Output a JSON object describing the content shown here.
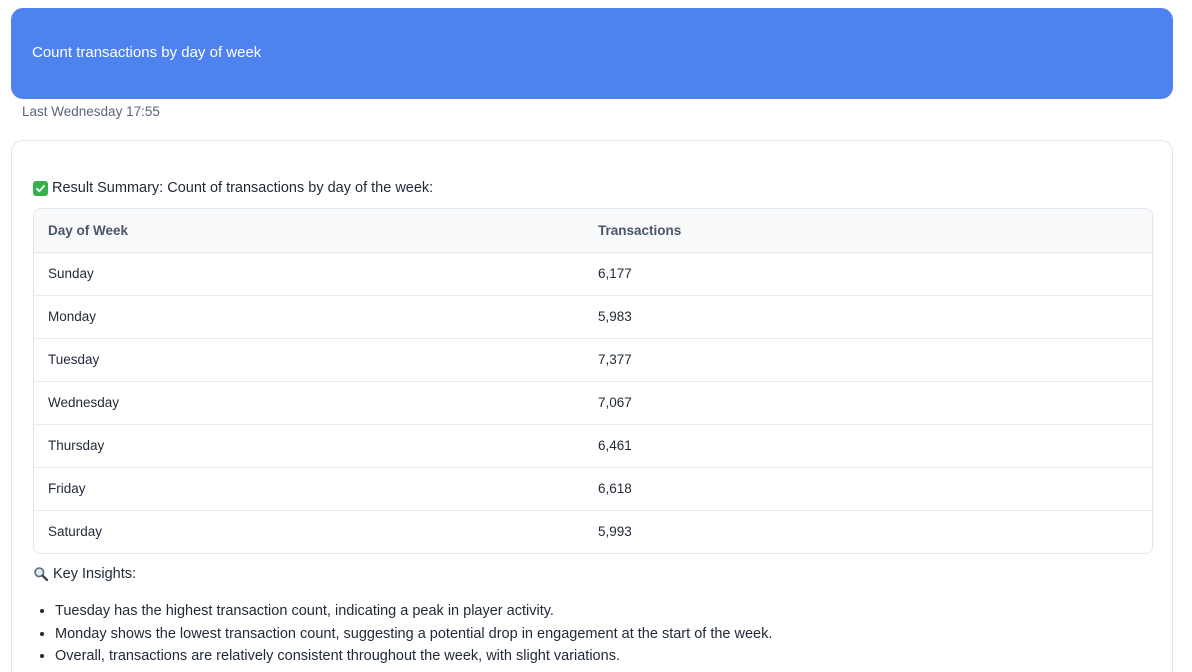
{
  "user_message": {
    "text": "Count transactions by day of week",
    "timestamp": "Last Wednesday 17:55"
  },
  "response": {
    "summary_icon": "check-mark-icon",
    "summary_text": "Result Summary: Count of transactions by day of the week:",
    "table": {
      "headers": [
        "Day of Week",
        "Transactions"
      ],
      "rows": [
        [
          "Sunday",
          "6,177"
        ],
        [
          "Monday",
          "5,983"
        ],
        [
          "Tuesday",
          "7,377"
        ],
        [
          "Wednesday",
          "7,067"
        ],
        [
          "Thursday",
          "6,461"
        ],
        [
          "Friday",
          "6,618"
        ],
        [
          "Saturday",
          "5,993"
        ]
      ]
    },
    "insights_icon": "magnifier-icon",
    "insights_heading": "Key Insights:",
    "insights": [
      "Tuesday has the highest transaction count, indicating a peak in player activity.",
      "Monday shows the lowest transaction count, suggesting a potential drop in engagement at the start of the week.",
      "Overall, transactions are relatively consistent throughout the week, with slight variations."
    ]
  },
  "colors": {
    "user_bubble": "#4e82ee",
    "check_green": "#34b14a",
    "header_bg": "#f8f9fa",
    "border": "#e3e6ea"
  }
}
